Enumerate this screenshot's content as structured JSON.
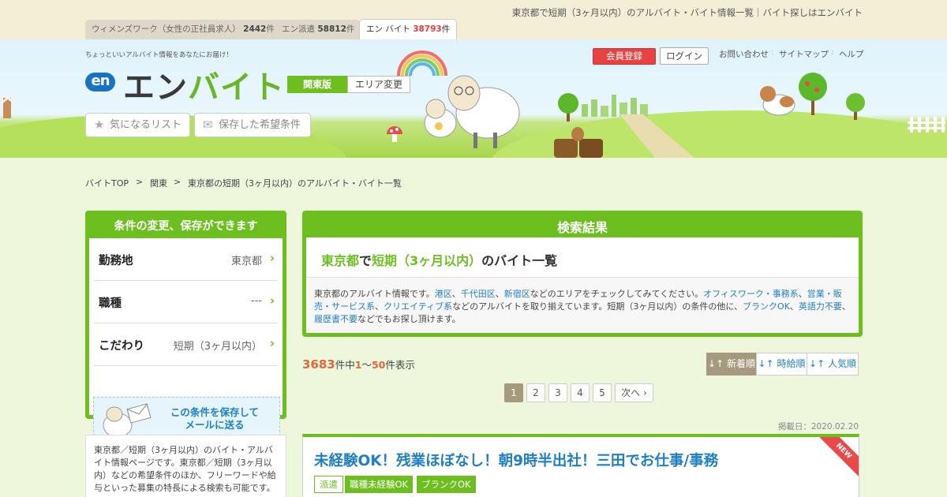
{
  "header": {
    "page_title": "東京都で短期（3ヶ月以内）のアルバイト・バイト情報一覧｜バイト探しはエンバイト",
    "tabs": [
      {
        "label": "ウィメンズワーク（女性の正社員求人）",
        "count": "2442",
        "unit": "件"
      },
      {
        "label": "エン派遣",
        "count": "58812",
        "unit": "件"
      },
      {
        "label": "エン バイト",
        "count": "38793",
        "unit": "件"
      }
    ],
    "tagline": "ちょっといいアルバイト情報をあなたにお届け！",
    "logo_mark": "en",
    "logo_text_a": "エン",
    "logo_text_b": "バイト",
    "region_badge": "関東版",
    "area_change": "エリア変更",
    "favorites_button": "気になるリスト",
    "saved_conditions_button": "保存した希望条件",
    "register_button": "会員登録",
    "login_button": "ログイン",
    "links": [
      "お問い合わせ",
      "サイトマップ",
      "ヘルプ"
    ]
  },
  "breadcrumb": [
    "バイトTOP",
    ">",
    "関東",
    ">",
    "東京都の短期（3ヶ月以内）のアルバイト・バイト一覧"
  ],
  "sidebar": {
    "heading": "条件の変更、保存ができます",
    "criteria": [
      {
        "label": "勤務地",
        "value": "東京都"
      },
      {
        "label": "職種",
        "value": "---"
      },
      {
        "label": "こだわり",
        "value": "短期（3ヶ月以内）"
      }
    ],
    "save_text_1": "この条件を保存して",
    "save_text_2": "メールに送る",
    "description": "東京都／短期（3ヶ月以内）のバイト・アルバイト情報ページです。東京都／短期（3ヶ月以内）などの希望条件のほか、フリーワードや給与といった募集の特長による検索も可能です。"
  },
  "results": {
    "heading": "検索結果",
    "title_location": "東京都",
    "title_de": "で",
    "title_condition": "短期（3ヶ月以内）",
    "title_suffix": "のバイト一覧",
    "desc": {
      "p1": "東京都のアルバイト情報です。",
      "l1": "港区",
      "s1": "、",
      "l2": "千代田区",
      "s2": "、",
      "l3": "新宿区",
      "p2": "などのエリアをチェックしてみてください。",
      "l4": "オフィスワーク・事務系",
      "s3": "、",
      "l5": "営業・販売・サービス系",
      "s4": "、",
      "l6": "クリエイティブ系",
      "p3": "などのアルバイトを取り揃えています。短期（3ヶ月以内）の条件の他に、",
      "l7": "ブランクOK",
      "s5": "、",
      "l8": "英語力不要",
      "s6": "、",
      "l9": "履歴書不要",
      "p4": "などでもお探し頂けます。"
    },
    "total": "3683",
    "total_unit": "件中",
    "range_start": "1",
    "range_sep": "～",
    "range_end": "50",
    "range_suffix": "件表示",
    "sort": [
      "↓↑ 新着順",
      "↓↑ 時給順",
      "↓↑ 人気順"
    ],
    "pages": [
      "1",
      "2",
      "3",
      "4",
      "5"
    ],
    "next": "次へ"
  },
  "job": {
    "posted": "掲載日：2020.02.20",
    "title": "未経験OK！残業ほぼなし！朝9時半出社！三田でお仕事/事務",
    "badge": "NEW",
    "tags": [
      "派遣",
      "職種未経験OK",
      "ブランクOK"
    ]
  },
  "colors": {
    "green": "#6cbf1f",
    "blue": "#1f7fc6",
    "red": "#e84242",
    "orange": "#e0683c",
    "beige": "#a59a7d"
  }
}
